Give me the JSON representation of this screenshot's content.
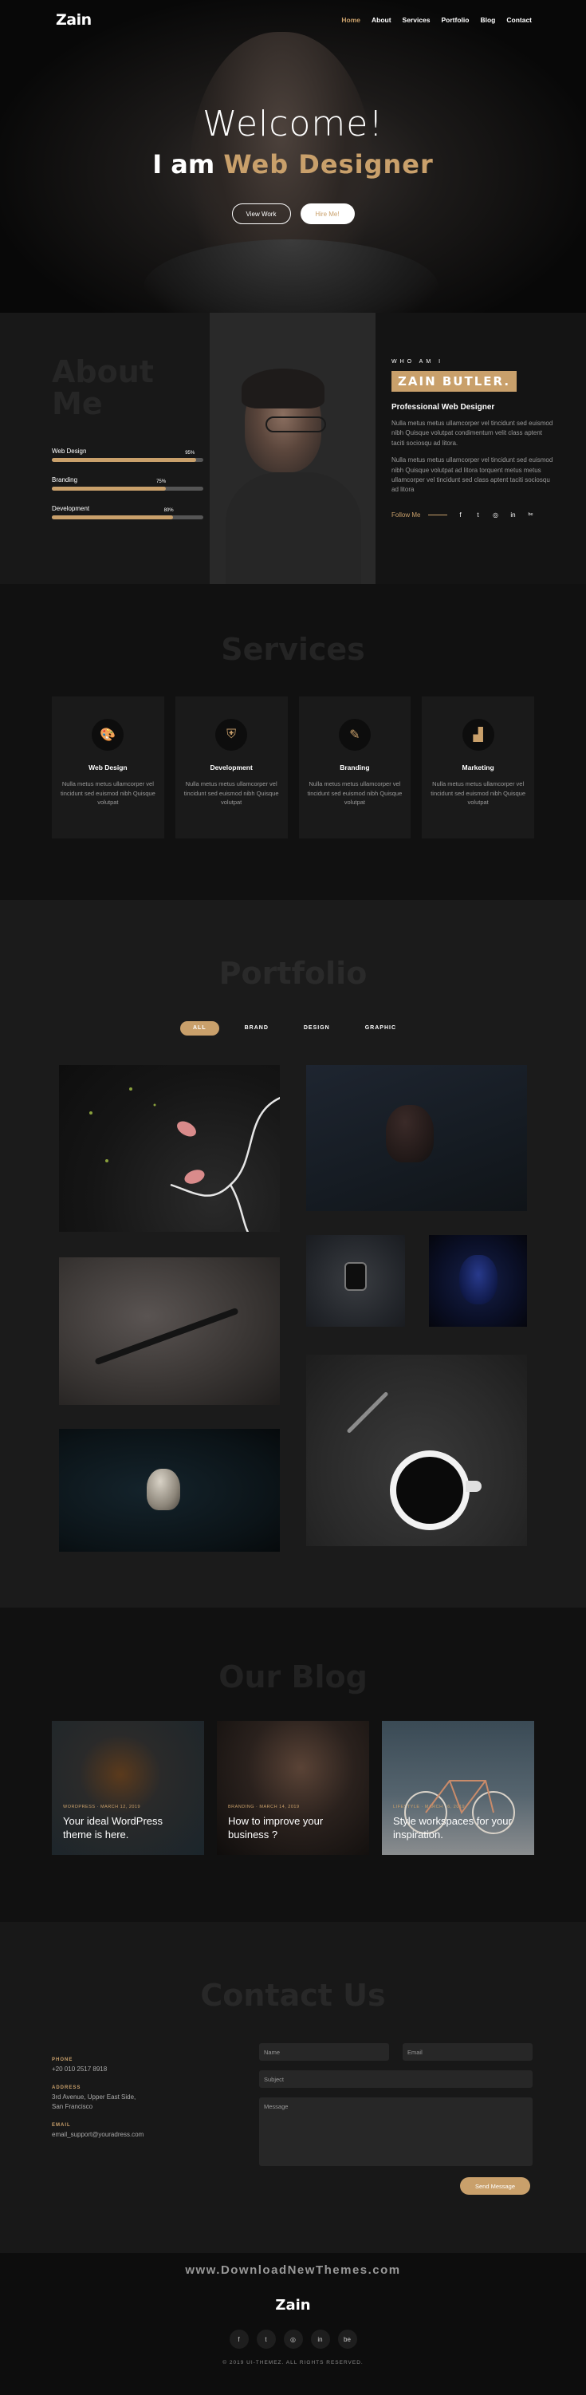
{
  "nav": {
    "logo": "Zain",
    "items": [
      "Home",
      "About",
      "Services",
      "Portfolio",
      "Blog",
      "Contact"
    ],
    "active": "Home"
  },
  "hero": {
    "welcome": "Welcome!",
    "lead": "I am",
    "highlight": "Web Designer",
    "btn_work": "View Work",
    "btn_hire": "Hire Me!"
  },
  "about": {
    "bg_title_line1": "About",
    "bg_title_line2": "Me",
    "skills": [
      {
        "label": "Web Design",
        "percent": "95%",
        "level": 0.95
      },
      {
        "label": "Branding",
        "percent": "75%",
        "level": 0.75
      },
      {
        "label": "Development",
        "percent": "80%",
        "level": 0.8
      }
    ],
    "who": "WHO AM I",
    "name": "ZAIN BUTLER.",
    "role": "Professional Web Designer",
    "para1": "Nulla metus metus ullamcorper vel tincidunt sed euismod nibh Quisque volutpat condimentum velit class aptent taciti sociosqu ad litora.",
    "para2": "Nulla metus metus ullamcorper vel tincidunt sed euismod nibh Quisque volutpat ad litora torquent metus metus ullamcorper vel tincidunt sed class aptent taciti sociosqu ad litora",
    "follow": "Follow Me",
    "social_icons": [
      "f",
      "t",
      "ig",
      "in",
      "be"
    ]
  },
  "services": {
    "title": "Services",
    "items": [
      {
        "title": "Web Design",
        "icon": "palette-icon",
        "glyph": "🎨",
        "desc": "Nulla metus metus ullamcorper vel tincidunt sed euismod nibh Quisque volutpat"
      },
      {
        "title": "Development",
        "icon": "shield-icon",
        "glyph": "⛨",
        "desc": "Nulla metus metus ullamcorper vel tincidunt sed euismod nibh Quisque volutpat"
      },
      {
        "title": "Branding",
        "icon": "pen-ruler-icon",
        "glyph": "✎",
        "desc": "Nulla metus metus ullamcorper vel tincidunt sed euismod nibh Quisque volutpat"
      },
      {
        "title": "Marketing",
        "icon": "chart-icon",
        "glyph": "📈",
        "desc": "Nulla metus metus ullamcorper vel tincidunt sed euismod nibh Quisque volutpat"
      }
    ]
  },
  "portfolio": {
    "title": "Portfolio",
    "filters": [
      "ALL",
      "BRAND",
      "DESIGN",
      "GRAPHIC"
    ],
    "active_filter": "ALL"
  },
  "blog": {
    "title": "Our Blog",
    "posts": [
      {
        "meta": "WORDPRESS  ·  MARCH 12, 2019",
        "title": "Your ideal WordPress theme is here."
      },
      {
        "meta": "BRANDING  ·  MARCH 14, 2019",
        "title": "How to improve your business ?"
      },
      {
        "meta": "LIFESTYLE  ·  MARCH 16, 2019",
        "title": "Style workspaces for your inspiration."
      }
    ]
  },
  "contact": {
    "title": "Contact Us",
    "phone_label": "PHONE",
    "phone": "+20 010 2517 8918",
    "address_label": "ADDRESS",
    "address1": "3rd Avenue, Upper East Side,",
    "address2": "San Francisco",
    "email_label": "EMAIL",
    "email": "email_support@youradress.com",
    "name_placeholder": "Name",
    "email_placeholder": "Email",
    "subject_placeholder": "Subject",
    "message_placeholder": "Message",
    "send": "Send Message"
  },
  "footer": {
    "watermark": "www.DownloadNewThemes.com",
    "logo": "Zain",
    "social_icons": [
      "f",
      "t",
      "ig",
      "in",
      "be"
    ],
    "copyright": "© 2019 UI-THEMEZ. ALL RIGHTS RESERVED."
  }
}
